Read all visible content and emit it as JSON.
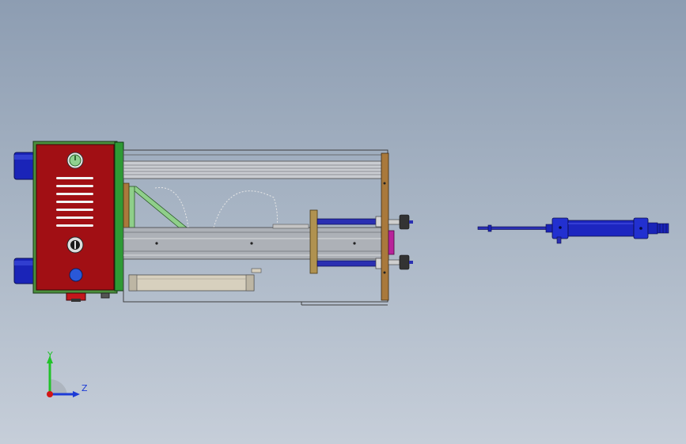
{
  "viewport": {
    "background_top": "#8d9db2",
    "background_bottom": "#c6ced9"
  },
  "colors": {
    "control_box": "#a10f14",
    "control_frame": "#4a8f3c",
    "side_plate": "#2e9a35",
    "cylinder_blue": "#1a24b8",
    "bronze_plate": "#a9793c",
    "magenta_block": "#b8229a",
    "y_axis": "#22c22a",
    "z_axis": "#1d3bd6",
    "origin": "#d21616"
  },
  "triad": {
    "y_label": "Y",
    "z_label": "Z"
  }
}
